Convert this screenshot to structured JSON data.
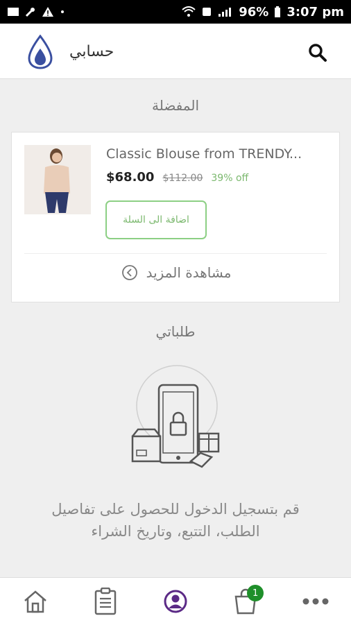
{
  "status_bar": {
    "battery": "96%",
    "time": "3:07 pm"
  },
  "app_bar": {
    "title": "حسابي"
  },
  "favorites": {
    "title": "المفضلة",
    "product": {
      "name": "Classic Blouse from TRENDY...",
      "price": "$68.00",
      "old_price": "$112.00",
      "discount": "39% off",
      "add_to_cart_label": "اضافة الى السلة"
    },
    "see_more_label": "مشاهدة المزيد"
  },
  "orders": {
    "title": "طلباتي",
    "message_line1": "قم بتسجيل الدخول للحصول على تفاصيل",
    "message_line2": "الطلب، التتبع، وتاريخ الشراء"
  },
  "bottom_nav": {
    "cart_badge": "1",
    "tabs": [
      "home-icon",
      "orders-icon",
      "account-icon",
      "cart-icon",
      "more-icon"
    ],
    "active_tab": "account-icon",
    "active_color": "#5b2a86"
  },
  "colors": {
    "accent_green": "#7bb86e",
    "badge_green": "#1f8f2a",
    "logo_blue": "#3a4fa0"
  }
}
